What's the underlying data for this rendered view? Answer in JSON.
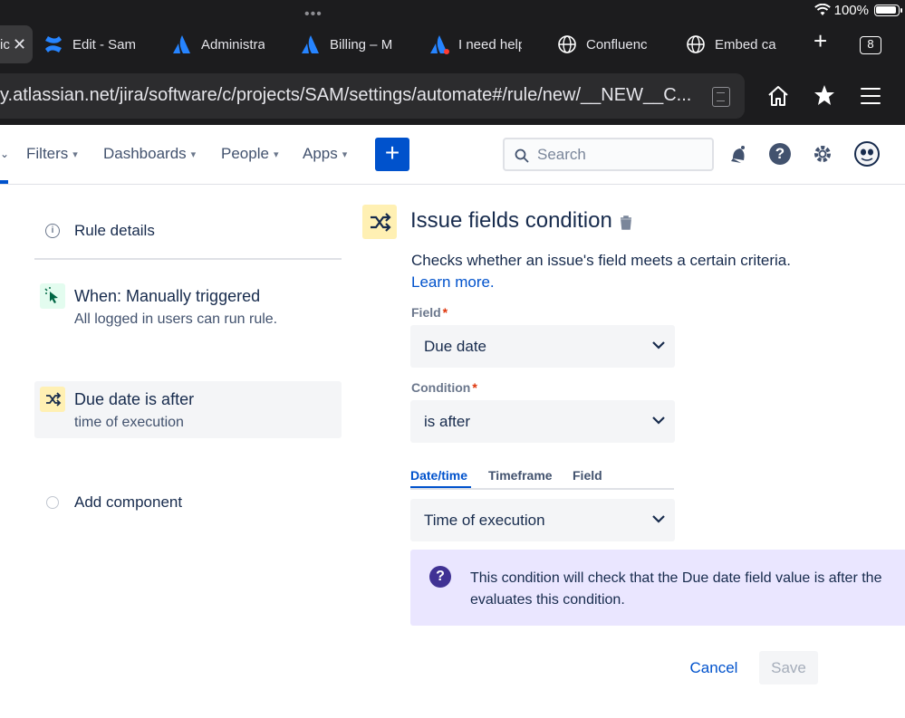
{
  "status_bar": {
    "dots": "•••",
    "battery_percent": "100%"
  },
  "browser": {
    "tabs": [
      {
        "label": "ic",
        "icon": "close-icon"
      },
      {
        "label": "Edit - Sam",
        "icon": "confluence-icon"
      },
      {
        "label": "Administra",
        "icon": "atlassian-icon"
      },
      {
        "label": "Billing – M",
        "icon": "atlassian-icon"
      },
      {
        "label": "I need help",
        "icon": "atlassian-icon"
      },
      {
        "label": "Confluenc",
        "icon": "globe-icon"
      },
      {
        "label": "Embed ca",
        "icon": "globe-icon"
      }
    ],
    "new_tab": "+",
    "tab_count": "8",
    "url": "y.atlassian.net/jira/software/c/projects/SAM/settings/automate#/rule/new/__NEW__C..."
  },
  "nav": {
    "items": [
      {
        "label": "Filters"
      },
      {
        "label": "Dashboards"
      },
      {
        "label": "People"
      },
      {
        "label": "Apps"
      }
    ],
    "create_label": "+",
    "search_placeholder": "Search",
    "help_label": "?"
  },
  "rule_list": {
    "rule_details": "Rule details",
    "trigger": {
      "title": "When: Manually triggered",
      "subtitle": "All logged in users can run rule."
    },
    "condition": {
      "title": "Due date is after",
      "subtitle": "time of execution"
    },
    "add_component": "Add component"
  },
  "panel": {
    "title": "Issue fields condition",
    "description": "Checks whether an issue's field meets a certain criteria.",
    "learn_more": "Learn more.",
    "field_label": "Field",
    "field_value": "Due date",
    "condition_label": "Condition",
    "condition_value": "is after",
    "required_marker": "*",
    "subtabs": [
      "Date/time",
      "Timeframe",
      "Field"
    ],
    "datetime_value": "Time of execution",
    "info_line1": "This condition will check that the Due date field value is after the",
    "info_line2": "evaluates this condition.",
    "cancel": "Cancel",
    "save": "Save"
  },
  "colors": {
    "brand_blue": "#0052cc",
    "condition_yellow": "#fff0b3",
    "trigger_green": "#e3fcef",
    "info_purple": "#eae6ff"
  }
}
